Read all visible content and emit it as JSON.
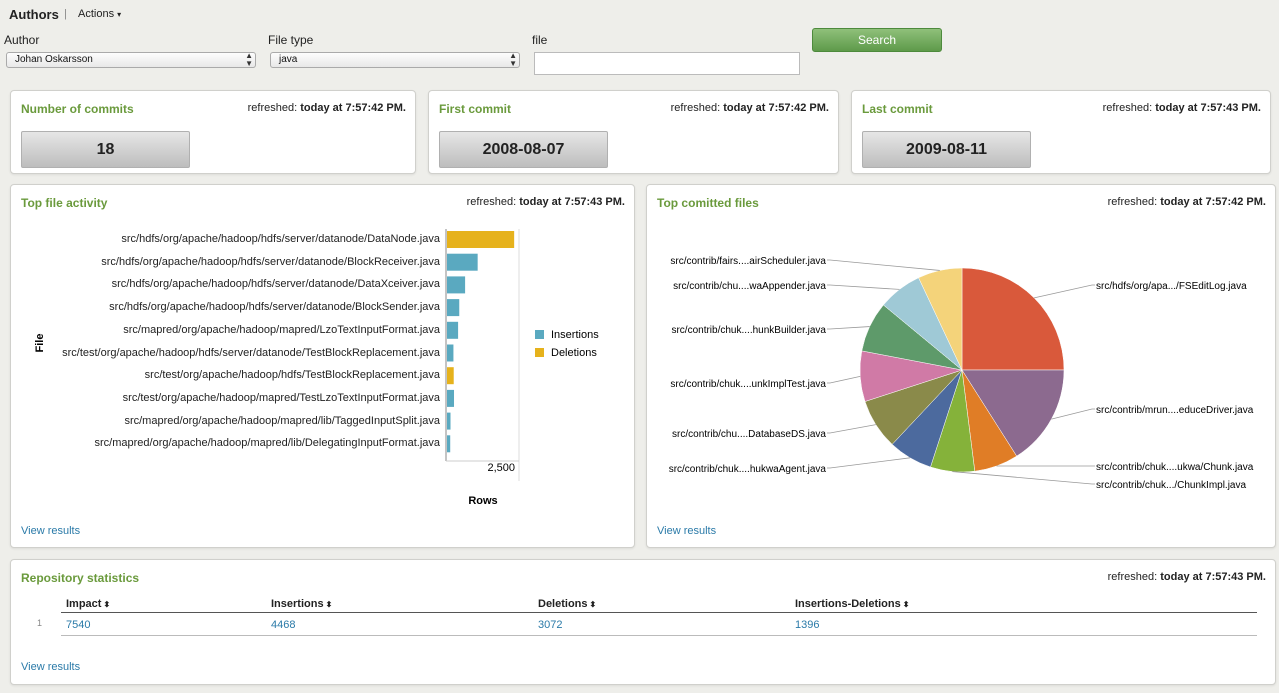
{
  "app": {
    "title": "Authors",
    "separator": "|",
    "actions_label": "Actions",
    "caret": "▾"
  },
  "filters": {
    "author_label": "Author",
    "author_value": "Johan Oskarsson",
    "filetype_label": "File type",
    "filetype_value": "java",
    "file_label": "file",
    "file_value": "",
    "search_label": "Search",
    "select_arrows": "▲▼"
  },
  "refreshed_prefix": "refreshed:",
  "stats": [
    {
      "title": "Number of commits",
      "refreshed": "today at 7:57:42 PM.",
      "value": "18"
    },
    {
      "title": "First commit",
      "refreshed": "today at 7:57:42 PM.",
      "value": "2008-08-07"
    },
    {
      "title": "Last commit",
      "refreshed": "today at 7:57:43 PM.",
      "value": "2009-08-11"
    }
  ],
  "file_activity": {
    "title": "Top file activity",
    "refreshed": "today at 7:57:43 PM.",
    "view_results": "View results"
  },
  "committed_files": {
    "title": "Top comitted files",
    "refreshed": "today at 7:57:42 PM.",
    "view_results": "View results"
  },
  "colors": {
    "insertions": "#5aa9c0",
    "deletions": "#e6b21c",
    "accent": "#6a9a3c",
    "link": "#2a7aa8"
  },
  "chart_data": [
    {
      "type": "bar",
      "orientation": "horizontal",
      "ylabel": "File",
      "xlabel": "Rows",
      "x_ticks": [
        "2,500"
      ],
      "xlim": [
        0,
        2500
      ],
      "legend_position": "right",
      "categories": [
        "src/hdfs/org/apache/hadoop/hdfs/server/datanode/DataNode.java",
        "src/hdfs/org/apache/hadoop/hdfs/server/datanode/BlockReceiver.java",
        "src/hdfs/org/apache/hadoop/hdfs/server/datanode/DataXceiver.java",
        "src/hdfs/org/apache/hadoop/hdfs/server/datanode/BlockSender.java",
        "src/mapred/org/apache/hadoop/mapred/LzoTextInputFormat.java",
        "src/test/org/apache/hadoop/hdfs/server/datanode/TestBlockReplacement.java",
        "src/test/org/apache/hadoop/hdfs/TestBlockReplacement.java",
        "src/test/org/apache/hadoop/mapred/TestLzoTextInputFormat.java",
        "src/mapred/org/apache/hadoop/mapred/lib/TaggedInputSplit.java",
        "src/mapred/org/apache/hadoop/mapred/lib/DelegatingInputFormat.java"
      ],
      "series": [
        {
          "name": "Insertions",
          "values": [
            0,
            1050,
            620,
            420,
            380,
            220,
            0,
            240,
            120,
            110
          ]
        },
        {
          "name": "Deletions",
          "values": [
            2300,
            0,
            0,
            0,
            0,
            0,
            230,
            0,
            0,
            0
          ]
        }
      ]
    },
    {
      "type": "pie",
      "slices": [
        {
          "label": "src/hdfs/org/apa.../FSEditLog.java",
          "value": 25,
          "color": "#d9593b"
        },
        {
          "label": "src/contrib/mrun....educeDriver.java",
          "value": 16,
          "color": "#8c6a8f"
        },
        {
          "label": "src/contrib/chuk....ukwa/Chunk.java",
          "value": 7,
          "color": "#e07d26"
        },
        {
          "label": "src/contrib/chuk.../ChunkImpl.java",
          "value": 7,
          "color": "#85b23a"
        },
        {
          "label": "src/contrib/chuk....hukwaAgent.java",
          "value": 7,
          "color": "#4c6a9e"
        },
        {
          "label": "src/contrib/chu....DatabaseDS.java",
          "value": 8,
          "color": "#8a8a4a"
        },
        {
          "label": "src/contrib/chuk....unkImplTest.java",
          "value": 8,
          "color": "#d07aa6"
        },
        {
          "label": "src/contrib/chuk....hunkBuilder.java",
          "value": 8,
          "color": "#5e9a6a"
        },
        {
          "label": "src/contrib/chu....waAppender.java",
          "value": 7,
          "color": "#9fc9d6"
        },
        {
          "label": "src/contrib/fairs....airScheduler.java",
          "value": 7,
          "color": "#f4d37a"
        }
      ]
    }
  ],
  "repo_stats": {
    "title": "Repository statistics",
    "refreshed": "today at 7:57:43 PM.",
    "headers": [
      "Impact",
      "Insertions",
      "Deletions",
      "Insertions-Deletions"
    ],
    "sort_icon": "⬍",
    "rows": [
      {
        "index": "1",
        "cells": [
          "7540",
          "4468",
          "3072",
          "1396"
        ]
      }
    ],
    "view_results": "View results"
  }
}
